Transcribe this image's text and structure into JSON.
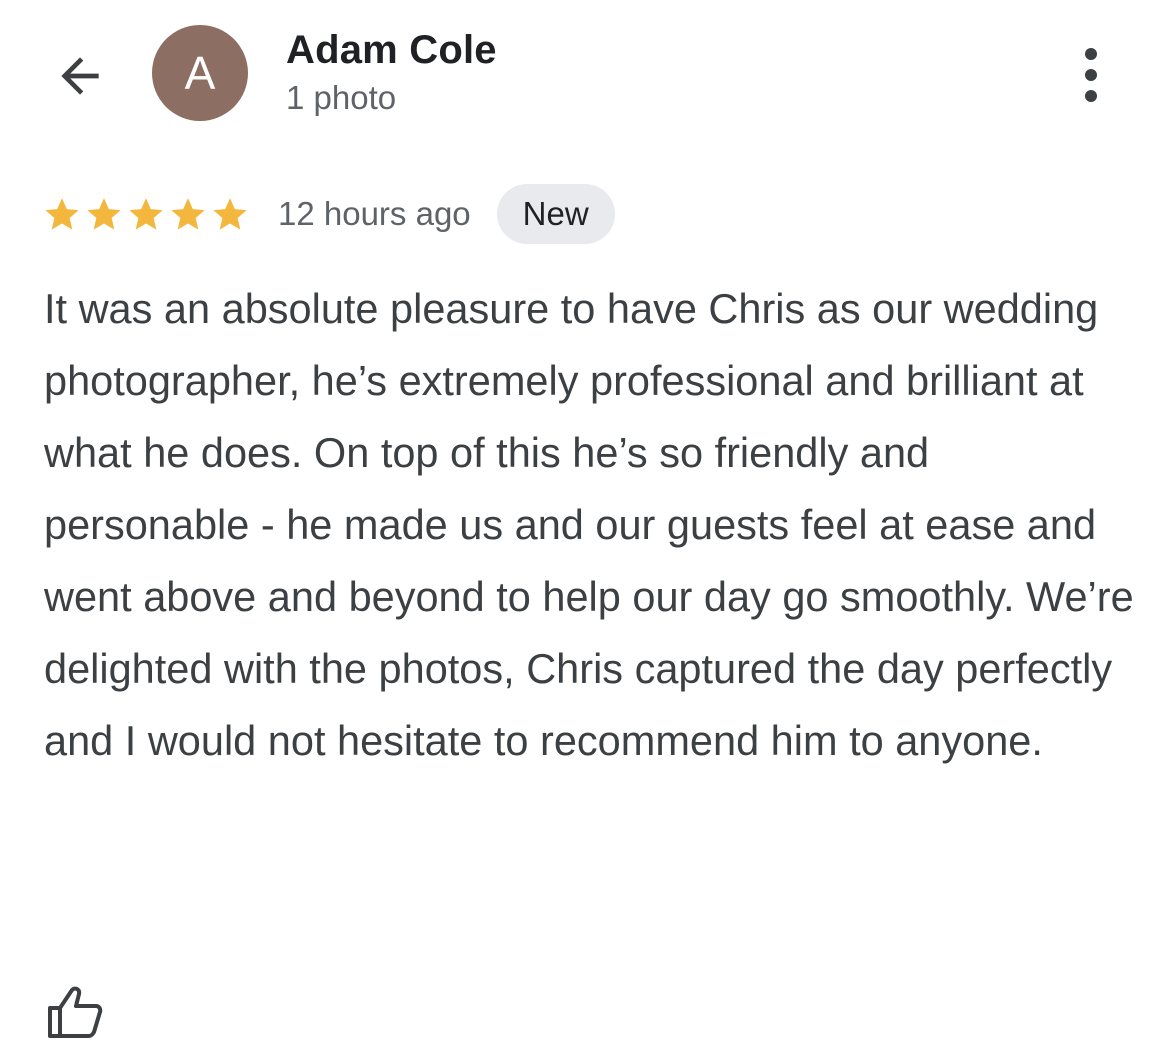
{
  "header": {
    "back_icon": "arrow-back-icon",
    "avatar_letter": "A",
    "avatar_color": "#8d6e63",
    "reviewer_name": "Adam Cole",
    "reviewer_subtitle": "1 photo",
    "more_icon": "more-vert-icon"
  },
  "review": {
    "rating": 5,
    "rating_max": 5,
    "star_color": "#f4b73e",
    "time": "12 hours ago",
    "badge": "New",
    "text": "It was an absolute pleasure to have Chris as our wedding photographer, he’s extremely professional and brilliant at what he does. On top of this he’s so friendly and personable - he made us and our guests feel at ease and went above and beyond to help our day go smoothly. We’re delighted with the photos, Chris captured the day perfectly and I would not hesitate to recommend him to anyone."
  },
  "actions": {
    "like_icon": "thumbs-up-icon"
  }
}
